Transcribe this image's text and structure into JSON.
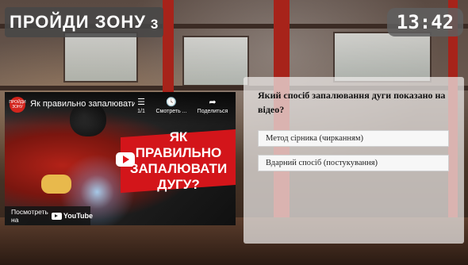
{
  "header": {
    "title": "ПРОЙДИ ЗОНУ",
    "zone_number": "3",
    "timer": "13:42"
  },
  "video": {
    "channel_avatar_text": "ПРОЙДИ ЗОНУ",
    "title": "Як правильно запалювати...",
    "playlist_count": "1/1",
    "watch_later_label": "Смотреть ...",
    "share_label": "Поделиться",
    "thumbnail_text": "ЯК ПРАВИЛЬНО ЗАПАЛЮВАТИ ДУГУ?",
    "watch_on_label": "Посмотреть на",
    "youtube_label": "YouTube",
    "brand_color": "#d3151a"
  },
  "quiz": {
    "question": "Який спосіб запалювання дуги показано на відео?",
    "options": [
      "Метод сірника (чирканням)",
      "Вдарний спосіб (постукування)"
    ]
  }
}
